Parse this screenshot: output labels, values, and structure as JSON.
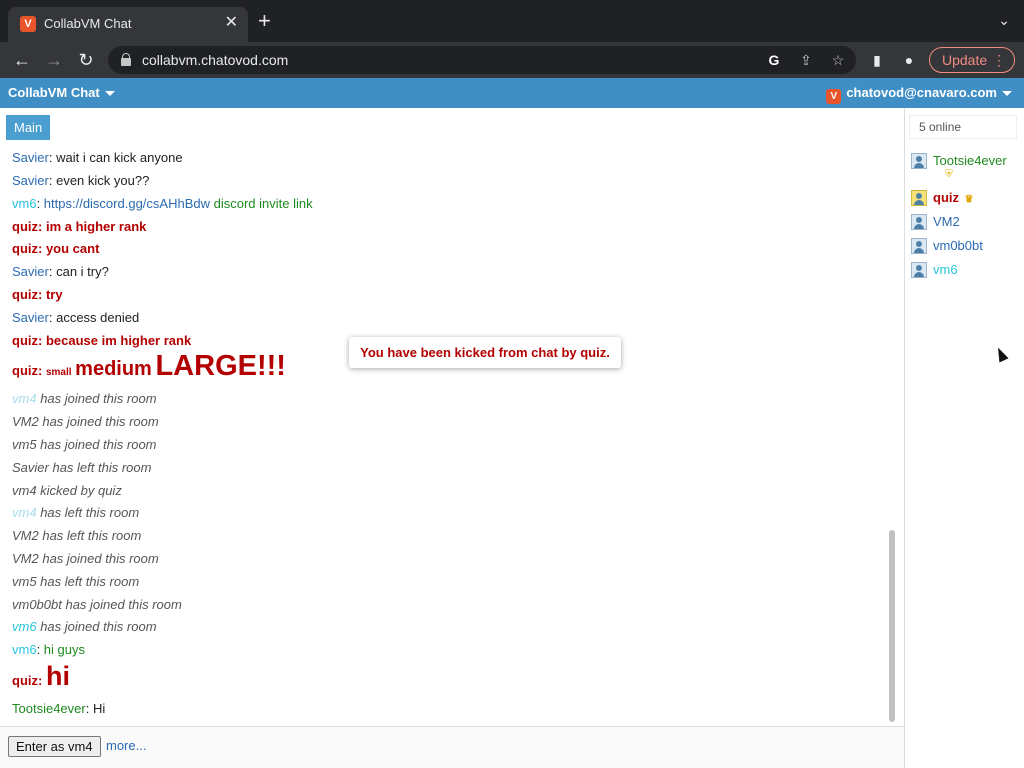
{
  "browser": {
    "tab_title": "CollabVM Chat",
    "favicon_letter": "V",
    "url": "collabvm.chatovod.com",
    "update_label": "Update"
  },
  "header": {
    "app_title": "CollabVM Chat",
    "user_label": "chatovod@cnavaro.com"
  },
  "room_tab": "Main",
  "messages": [
    {
      "name": "Savier",
      "text": "wait i can kick anyone"
    },
    {
      "name": "Savier",
      "text": "even kick you??"
    },
    {
      "name": "vm6",
      "link": "https://discord.gg/csAHhBdw",
      "text": " discord invite link"
    },
    {
      "name": "quiz",
      "text": "im a higher rank"
    },
    {
      "name": "quiz",
      "text": "you cant"
    },
    {
      "name": "Savier",
      "text": "can i try?"
    },
    {
      "name": "quiz",
      "text": "try"
    },
    {
      "name": "Savier",
      "text": "access denied"
    },
    {
      "name": "quiz",
      "text": "because im higher rank"
    },
    {
      "name": "quiz",
      "parts": [
        "small",
        "medium",
        "LARGE!!!"
      ]
    },
    {
      "name": "vm4",
      "text": "has joined this room"
    },
    {
      "system": "VM2 has joined this room"
    },
    {
      "system": "vm5 has joined this room"
    },
    {
      "system": "Savier has left this room"
    },
    {
      "system": "vm4 kicked by quiz"
    },
    {
      "name": "vm4",
      "text": "has left this room"
    },
    {
      "system": "VM2 has left this room"
    },
    {
      "system": "VM2 has joined this room"
    },
    {
      "system": "vm5 has left this room"
    },
    {
      "system": "vm0b0bt has joined this room"
    },
    {
      "name": "vm6",
      "text": "has joined this room"
    },
    {
      "name": "vm6",
      "text": "hi guys"
    },
    {
      "name": "quiz",
      "text": "hi"
    },
    {
      "name": "Tootsie4ever",
      "text": "Hi"
    }
  ],
  "separator": ": ",
  "toast": "You have been kicked from chat by quiz.",
  "input_bar": {
    "enter_label": "Enter as vm4",
    "more_label": "more..."
  },
  "sidebar": {
    "online_count": "5 online",
    "users": [
      "Tootsie4ever",
      "quiz",
      "VM2",
      "vm0b0bt",
      "vm6"
    ]
  },
  "colors": {
    "header_bg": "#3f8ec4",
    "room_tab_bg": "#4a9ed0",
    "admin_red": "#b30000",
    "user_blue": "#2a6bb1",
    "guest_cyan": "#27c4de",
    "moderator_green": "#1f8a1f"
  }
}
